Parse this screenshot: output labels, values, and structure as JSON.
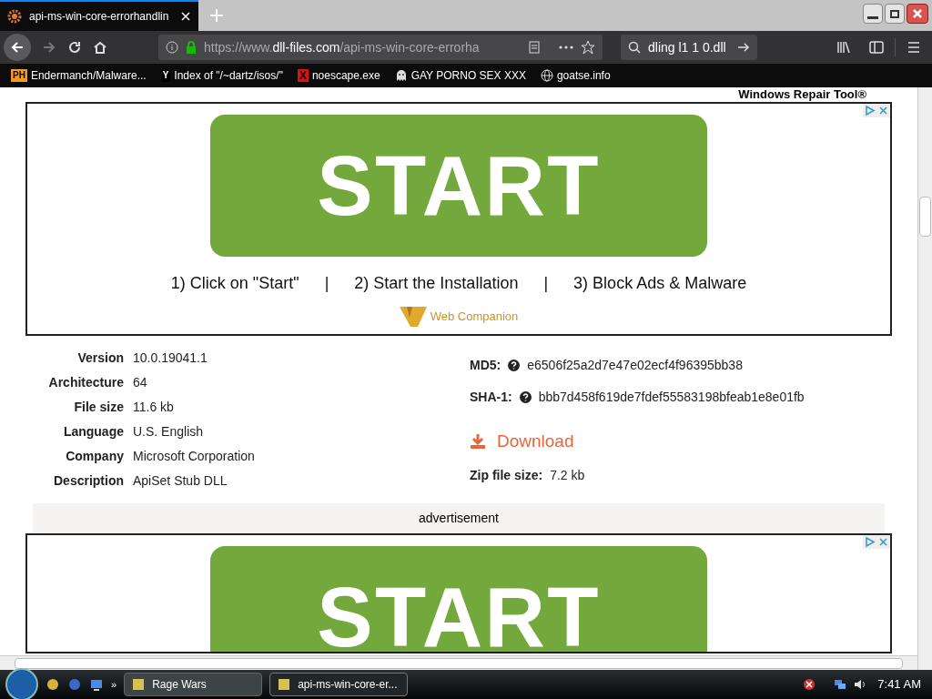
{
  "browser": {
    "tab": {
      "title": "api-ms-win-core-errorhandlin"
    },
    "url": {
      "prefix": "https://www.",
      "domain": "dll-files.com",
      "path": "/api-ms-win-core-errorha"
    },
    "search": {
      "value": "dling l1 1 0.dll"
    },
    "bookmarks": [
      {
        "kind": "ph",
        "badge": "PH",
        "label": "Endermanch/Malware..."
      },
      {
        "kind": "yc",
        "badge": "Y",
        "label": "Index of \"/~dartz/isos/\""
      },
      {
        "kind": "x",
        "badge": "X",
        "label": "noescape.exe"
      },
      {
        "kind": "ghost",
        "label": "GAY PORNO SEX XXX"
      },
      {
        "kind": "globe",
        "label": "goatse.info"
      }
    ]
  },
  "page": {
    "header_text": "Windows Repair Tool®",
    "ads": [
      {
        "button": "START",
        "steps": [
          "1) Click on \"Start\"",
          "|",
          "2) Start the Installation",
          "|",
          "3) Block Ads & Malware"
        ],
        "brand": "Web Companion"
      },
      {
        "button": "START"
      }
    ],
    "details": [
      {
        "label": "Version",
        "value": "10.0.19041.1"
      },
      {
        "label": "Architecture",
        "value": "64"
      },
      {
        "label": "File size",
        "value": "11.6 kb"
      },
      {
        "label": "Language",
        "value": "U.S. English"
      },
      {
        "label": "Company",
        "value": "Microsoft Corporation"
      },
      {
        "label": "Description",
        "value": "ApiSet Stub DLL"
      }
    ],
    "hashes": [
      {
        "label": "MD5:",
        "value": "e6506f25a2d7e47e02ecf4f96395bb38"
      },
      {
        "label": "SHA-1:",
        "value": "bbb7d458f619de7fdef55583198bfeab1e8e01fb"
      }
    ],
    "download": {
      "label": "Download"
    },
    "zip": {
      "label": "Zip file size:",
      "value": "7.2 kb"
    },
    "advertisement_label": "advertisement"
  },
  "taskbar": {
    "overflow": "»",
    "tasks": [
      {
        "title": "Rage Wars",
        "selected": false
      },
      {
        "title": "api-ms-win-core-er...",
        "selected": true
      }
    ],
    "clock": "7:41 AM"
  }
}
